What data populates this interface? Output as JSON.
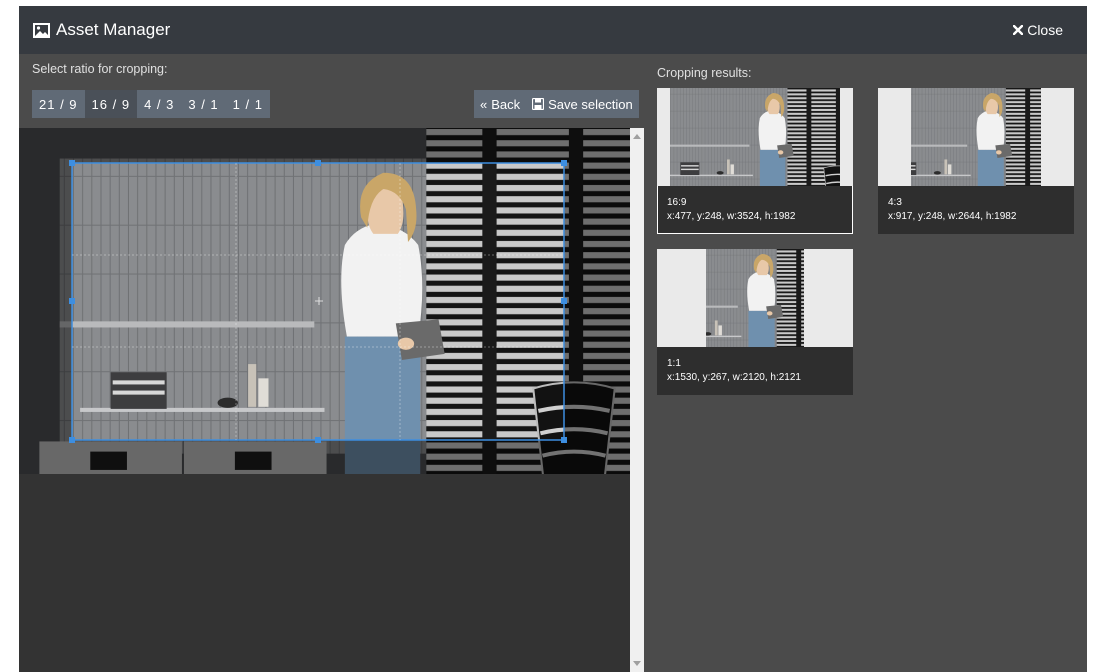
{
  "header": {
    "title": "Asset Manager",
    "close_label": "Close"
  },
  "toolbar": {
    "ratio_prompt": "Select ratio for cropping:",
    "ratios": [
      {
        "label": "21 / 9",
        "active": false
      },
      {
        "label": "16 / 9",
        "active": true
      },
      {
        "label": "4 / 3",
        "active": false
      },
      {
        "label": "3 / 1",
        "active": false
      },
      {
        "label": "1 / 1",
        "active": false
      }
    ],
    "back_label": "Back",
    "save_label": "Save selection"
  },
  "results": {
    "title": "Cropping results:",
    "items": [
      {
        "ratio": "16:9",
        "coords": "x:477, y:248, w:3524, h:1982"
      },
      {
        "ratio": "4:3",
        "coords": "x:917, y:248, w:2644, h:1982"
      },
      {
        "ratio": "1:1",
        "coords": "x:1530, y:267, w:2120, h:2121"
      }
    ]
  },
  "colors": {
    "header": "#363a40",
    "panel": "#4b4b4b",
    "button": "#606a76",
    "crop_border": "#3d8ee0"
  }
}
